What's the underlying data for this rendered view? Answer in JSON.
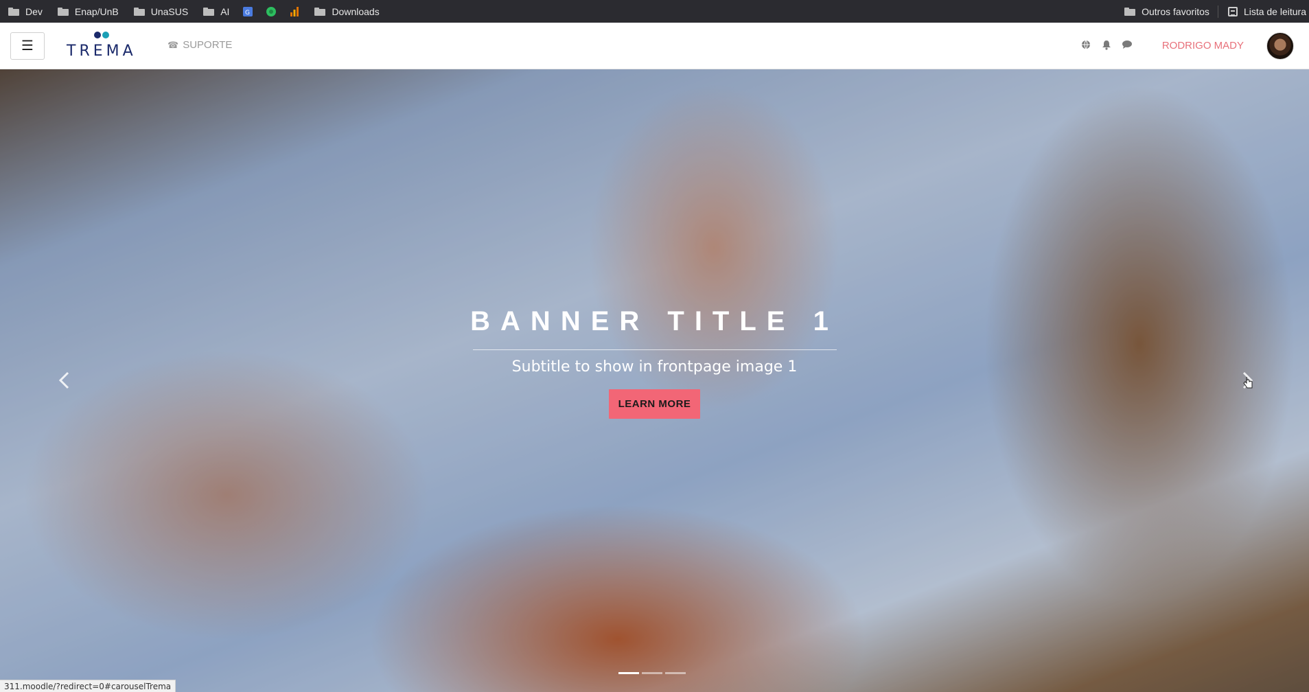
{
  "bookmarks": {
    "items": [
      {
        "label": "Dev",
        "type": "folder"
      },
      {
        "label": "Enap/UnB",
        "type": "folder"
      },
      {
        "label": "UnaSUS",
        "type": "folder"
      },
      {
        "label": "AI",
        "type": "folder"
      },
      {
        "label": "",
        "type": "translate-icon"
      },
      {
        "label": "",
        "type": "evernote-icon"
      },
      {
        "label": "",
        "type": "analytics-icon"
      },
      {
        "label": "Downloads",
        "type": "folder"
      }
    ],
    "other_favorites": "Outros favoritos",
    "reading_list": "Lista de leitura"
  },
  "navbar": {
    "logo_text": "TREMA",
    "support_label": "SUPORTE",
    "user_name": "RODRIGO MADY",
    "accent_color": "#e8707a"
  },
  "hero": {
    "title": "BANNER TITLE 1",
    "subtitle": "Subtitle to show in frontpage image 1",
    "cta_label": "LEARN MORE",
    "cta_color": "#f26676",
    "slide_count": 3,
    "active_slide": 1
  },
  "status": {
    "url": "311.moodle/?redirect=0#carouselTrema"
  }
}
